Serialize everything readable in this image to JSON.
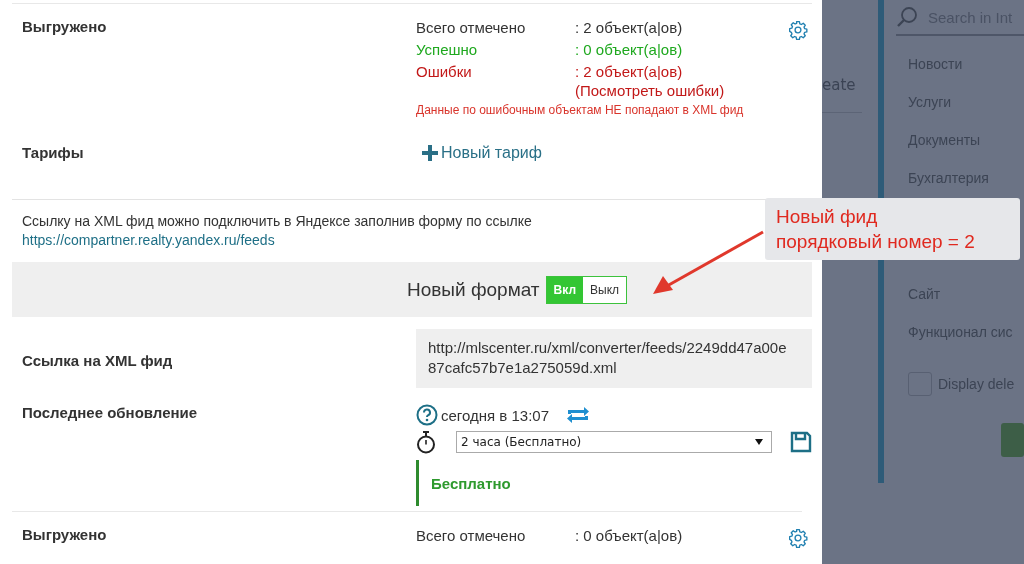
{
  "upload_top": {
    "label": "Выгружено",
    "stats": [
      {
        "kind": "total",
        "label": "Всего отмечено",
        "value": ": 2 объект(а|ов)"
      },
      {
        "kind": "success",
        "label": "Успешно",
        "value": ": 0 объект(а|ов)"
      },
      {
        "kind": "error",
        "label": "Ошибки",
        "value": ": 2 объект(а|ов)",
        "link": "(Посмотреть ошибки)"
      }
    ],
    "warning": "Данные по ошибочным объектам НЕ попадают в XML фид"
  },
  "tariffs": {
    "label": "Тарифы",
    "add_link": "Новый тариф"
  },
  "note": {
    "text": "Ссылку на XML фид можно подключить в Яндексе заполнив форму по ссылке",
    "link": "https://compartner.realty.yandex.ru/feeds"
  },
  "format": {
    "label": "Новый формат",
    "options": [
      {
        "label": "Вкл",
        "selected": true
      },
      {
        "label": "Выкл",
        "selected": false
      }
    ]
  },
  "feed_link": {
    "label": "Ссылка на XML фид",
    "value": "http://mlscenter.ru/xml/converter/feeds/2249dd47a00e87cafc57b7e1a275059d.xml"
  },
  "last_update": {
    "label": "Последнее обновление",
    "time": "сегодня в 13:07",
    "interval": "2 часа (Бесплатно)",
    "plan": "Бесплатно"
  },
  "upload_bottom": {
    "label": "Выгружено",
    "stats": [
      {
        "kind": "total",
        "label": "Всего отмечено",
        "value": ": 0 объект(а|ов)"
      }
    ]
  },
  "background": {
    "button_fragment": "eate",
    "search_placeholder": "Search in Int",
    "menu": [
      "Новости",
      "Услуги",
      "Документы",
      "Бухгалтерия",
      "Сайт",
      "Функционал сис"
    ],
    "checkbox": {
      "label": "Display dele",
      "checked": false
    }
  },
  "annotation": {
    "lines": [
      "Новый фид",
      "порядковый номер = 2"
    ]
  }
}
